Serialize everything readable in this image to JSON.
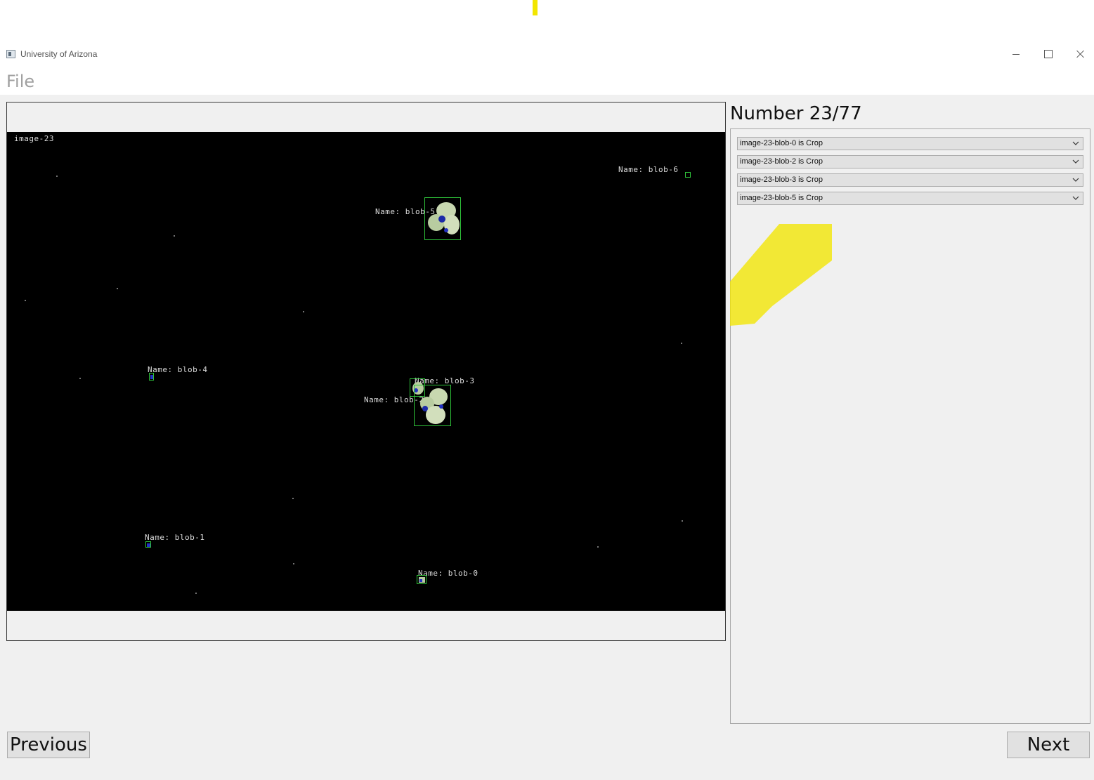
{
  "window": {
    "title": "University of Arizona"
  },
  "menu": {
    "file_label": "File"
  },
  "header": {
    "number_label": "Number 23/77"
  },
  "image": {
    "name": "image-23",
    "blob_labels": [
      "Name: blob-6",
      "Name: blob-5",
      "Name: blob-4",
      "Name: blob-3",
      "Name: blob-2",
      "Name: blob-1",
      "Name: blob-0"
    ]
  },
  "classifications": [
    {
      "text": "image-23-blob-0 is Crop"
    },
    {
      "text": "image-23-blob-2 is Crop"
    },
    {
      "text": "image-23-blob-3 is Crop"
    },
    {
      "text": "image-23-blob-5 is Crop"
    }
  ],
  "buttons": {
    "previous_label": "Previous",
    "next_label": "Next"
  },
  "colors": {
    "highlight": "#f2e600",
    "bbox": "#2fc43a",
    "plot_background": "#000000"
  }
}
